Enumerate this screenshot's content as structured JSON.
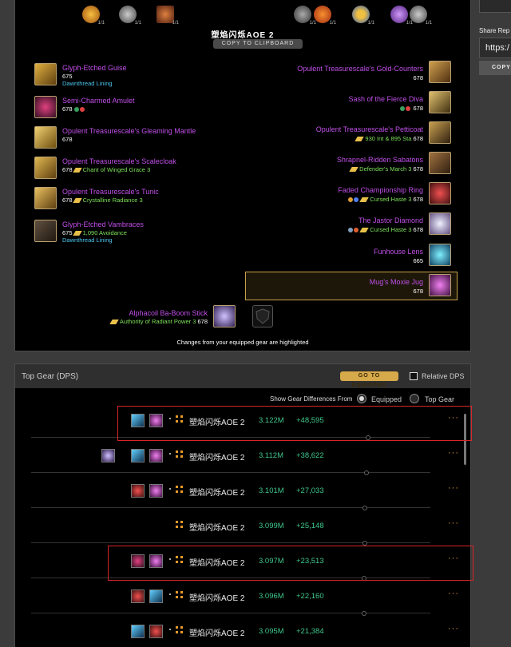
{
  "character": {
    "name": "塑焰闪烁AOE 2",
    "copy_button": "COPY TO CLIPBOARD"
  },
  "top_icons": [
    {
      "icon": "fire-orb-icon",
      "level": "1/1",
      "color": "#e8a020"
    },
    {
      "icon": "dragon-rune-icon",
      "level": "1/1",
      "color": "#888888"
    },
    {
      "icon": "ember-flask-icon",
      "level": "1/1",
      "color": "#c05a20"
    },
    {
      "icon": "rune-gear-icon",
      "level": "1/1",
      "color": "#888888"
    },
    {
      "icon": "flame-sphere-icon",
      "level": "1/1",
      "color": "#e86a10"
    },
    {
      "icon": "blue-ring-icon",
      "level": "1/1",
      "color": "#3a7ae0"
    },
    {
      "icon": "arcane-orb-icon",
      "level": "1/1",
      "color": "#9a4ae0"
    },
    {
      "icon": "wind-rune-icon",
      "level": "1/1",
      "color": "#888888"
    }
  ],
  "left_gear": [
    {
      "name": "Glyph-Etched Guise",
      "ilvl": "675",
      "extra": "",
      "enchant": "",
      "gems": false,
      "bonus": "Dawnthread Lining"
    },
    {
      "name": "Semi-Charmed Amulet",
      "ilvl": "678",
      "extra": "",
      "enchant": "",
      "gems": true,
      "bonus": ""
    },
    {
      "name": "Opulent Treasurescale's Gleaming Mantle",
      "ilvl": "678",
      "extra": "",
      "enchant": "",
      "gems": false,
      "bonus": ""
    },
    {
      "name": "Opulent Treasurescale's Scalecloak",
      "ilvl": "678",
      "extra": "",
      "enchant": "Chant of Winged Grace 3",
      "gems": false,
      "bonus": ""
    },
    {
      "name": "Opulent Treasurescale's Tunic",
      "ilvl": "678",
      "extra": "",
      "enchant": "Crystalline Radiance 3",
      "gems": false,
      "bonus": ""
    },
    {
      "name": "Glyph-Etched Vambraces",
      "ilvl": "675",
      "extra": "",
      "enchant": "1,090 Avoidance",
      "gems": false,
      "bonus": "Dawnthread Lining"
    }
  ],
  "right_gear": [
    {
      "name": "Opulent Treasurescale's Gold-Counters",
      "ilvl": "678",
      "enchant": "",
      "gems": false
    },
    {
      "name": "Sash of the Fierce Diva",
      "ilvl": "678",
      "enchant": "",
      "gems": true
    },
    {
      "name": "Opulent Treasurescale's Petticoat",
      "ilvl": "",
      "enchant": "930 Int & 895 Sta",
      "gems": false,
      "ilvl_after": "678"
    },
    {
      "name": "Shrapnel-Ridden Sabatons",
      "ilvl": "678",
      "enchant": "Defender's March 3",
      "gems": false
    },
    {
      "name": "Faded Championship Ring",
      "ilvl": "678",
      "enchant": "Cursed Haste 3",
      "gems": true
    },
    {
      "name": "The Jastor Diamond",
      "ilvl": "678",
      "enchant": "Cursed Haste 3",
      "gems": true
    },
    {
      "name": "Funhouse Lens",
      "ilvl": "665",
      "enchant": "",
      "gems": false
    },
    {
      "name": "Mug's Moxie Jug",
      "ilvl": "678",
      "enchant": "",
      "gems": false
    }
  ],
  "weapon": {
    "name": "Alphacoil Ba-Boom Stick",
    "ilvl": "678",
    "enchant": "Authority of Radiant Power 3"
  },
  "changes_note": "Changes from your equipped gear are highlighted",
  "top_gear": {
    "title": "Top Gear (DPS)",
    "goto_button": "GO TO EQUIPPED",
    "relative_label": "Relative DPS",
    "show_diff_label": "Show Gear Differences From",
    "option_equipped": "Equipped",
    "option_top": "Top Gear",
    "rows": [
      {
        "name": "塑焰闪烁AOE 2",
        "dps": "3.122M",
        "gain": "+48,595",
        "more": "···"
      },
      {
        "name": "塑焰闪烁AOE 2",
        "dps": "3.112M",
        "gain": "+38,622",
        "more": "···"
      },
      {
        "name": "塑焰闪烁AOE 2",
        "dps": "3.101M",
        "gain": "+27,033",
        "more": "···"
      },
      {
        "name": "塑焰闪烁AOE 2",
        "dps": "3.099M",
        "gain": "+25,148",
        "more": "···"
      },
      {
        "name": "塑焰闪烁AOE 2",
        "dps": "3.097M",
        "gain": "+23,513",
        "more": "···"
      },
      {
        "name": "塑焰闪烁AOE 2",
        "dps": "3.096M",
        "gain": "+22,160",
        "more": "···"
      },
      {
        "name": "塑焰闪烁AOE 2",
        "dps": "3.095M",
        "gain": "+21,384",
        "more": "···"
      }
    ]
  },
  "share": {
    "label": "Share Rep",
    "value": "https:/",
    "copy_button": "COPY"
  },
  "colors": {
    "item_name": "#c04fe8",
    "enchant": "#7de05a",
    "bonus": "#4cc7f0",
    "dps": "#3fc78c",
    "accent": "#d6a94a",
    "highlight_border": "#d8252a"
  }
}
